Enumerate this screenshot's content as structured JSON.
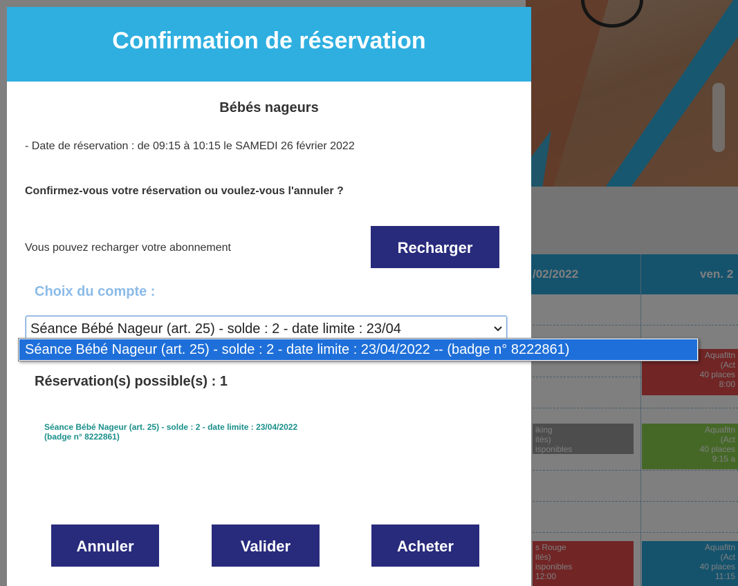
{
  "background": {
    "table_headers": [
      "/02/2022",
      "ven. 2"
    ],
    "cells": {
      "red_top": "Aquafitn\n(Act\n40 places\n8:00",
      "gray": "iking\nités)\nisponibles",
      "green": "Aquafitn\n(Act\n40 places\n9:15 a",
      "red_bottom": "s Rouge\nités)\nisponibles\n12:00",
      "blue_bottom": "Aquafitn\n(Act\n40 places\n11:15"
    }
  },
  "modal": {
    "title": "Confirmation de réservation",
    "course_name": "Bébés nageurs",
    "date_line": "- Date de réservation : de 09:15 à 10:15 le SAMEDI 26 février 2022",
    "confirm_question": "Confirmez-vous votre réservation ou voulez-vous l'annuler ?",
    "recharge_text": "Vous pouvez recharger votre abonnement",
    "recharge_button": "Recharger",
    "account_label": "Choix du compte :",
    "account_select": {
      "selected_value": "Séance Bébé Nageur (art. 25) - solde : 2 - date limite : 23/04",
      "options": [
        "Séance Bébé Nageur (art. 25) - solde : 2 - date limite : 23/04/2022 -- (badge n° 8222861)"
      ]
    },
    "possible_reservations": "Réservation(s) possible(s) : 1",
    "account_info_line1": "Séance Bébé Nageur (art. 25) - solde : 2 - date limite : 23/04/2022",
    "account_info_line2": "(badge n° 8222861)",
    "buttons": {
      "cancel": "Annuler",
      "validate": "Valider",
      "buy": "Acheter"
    }
  },
  "colors": {
    "header": "#2eafe0",
    "button": "#282b7c",
    "label_accent": "#8bbbe8",
    "info_text": "#1a8f8a",
    "dropdown_highlight": "#1e6fd9"
  }
}
